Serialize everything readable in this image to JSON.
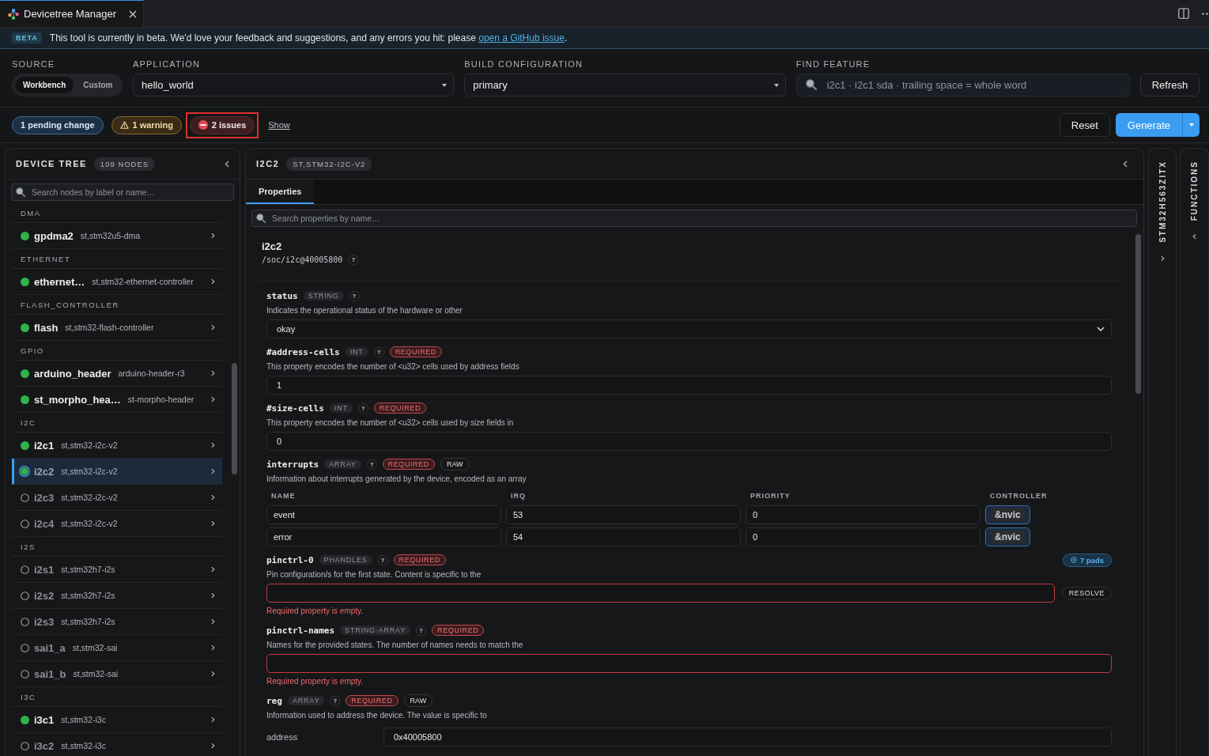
{
  "editor_tab": {
    "title": "Devicetree Manager"
  },
  "beta_banner": {
    "badge": "BETA",
    "message": "This tool is currently in beta. We'd love your feedback and suggestions, and any errors you hit: please",
    "link": "open a GitHub issue",
    "suffix": "."
  },
  "config": {
    "source": {
      "label": "SOURCE",
      "options": [
        {
          "label": "Workbench",
          "selected": true
        },
        {
          "label": "Custom",
          "selected": false
        }
      ]
    },
    "application": {
      "label": "APPLICATION",
      "value": "hello_world"
    },
    "build_configuration": {
      "label": "BUILD CONFIGURATION",
      "value": "primary"
    },
    "find_feature": {
      "label": "FIND FEATURE",
      "placeholder": "i2c1 · i2c1 sda · trailing space = whole word"
    },
    "refresh_button": "Refresh"
  },
  "status_bar": {
    "badges": [
      {
        "kind": "pending",
        "text": "1 pending change",
        "focused": false
      },
      {
        "kind": "warning",
        "text": "1 warning",
        "focused": false
      },
      {
        "kind": "error",
        "text": "2 issues",
        "focused": true
      }
    ],
    "show_link": "Show",
    "reset_button": "Reset",
    "generate_button": "Generate"
  },
  "device_tree": {
    "title": "DEVICE TREE",
    "count": "109 NODES",
    "search": {
      "placeholder": "Search nodes by label or name…"
    },
    "groups": [
      {
        "label": "DMA",
        "nodes": [
          {
            "name": "gpdma2",
            "compatible": "st,stm32u5-dma",
            "enabled": true,
            "selected": false
          }
        ]
      },
      {
        "label": "ETHERNET",
        "nodes": [
          {
            "name": "ethernet…",
            "compatible": "st,stm32-ethernet-controller",
            "enabled": true,
            "selected": false
          }
        ]
      },
      {
        "label": "FLASH_CONTROLLER",
        "nodes": [
          {
            "name": "flash",
            "compatible": "st,stm32-flash-controller",
            "enabled": true,
            "selected": false
          }
        ]
      },
      {
        "label": "GPIO",
        "nodes": [
          {
            "name": "arduino_header",
            "compatible": "arduino-header-r3",
            "enabled": true,
            "selected": false
          },
          {
            "name": "st_morpho_hea…",
            "compatible": "st-morpho-header",
            "enabled": true,
            "selected": false
          }
        ]
      },
      {
        "label": "I2C",
        "nodes": [
          {
            "name": "i2c1",
            "compatible": "st,stm32-i2c-v2",
            "enabled": true,
            "selected": false
          },
          {
            "name": "i2c2",
            "compatible": "st,stm32-i2c-v2",
            "enabled": true,
            "selected": true
          },
          {
            "name": "i2c3",
            "compatible": "st,stm32-i2c-v2",
            "enabled": false,
            "selected": false
          },
          {
            "name": "i2c4",
            "compatible": "st,stm32-i2c-v2",
            "enabled": false,
            "selected": false
          }
        ]
      },
      {
        "label": "I2S",
        "nodes": [
          {
            "name": "i2s1",
            "compatible": "st,stm32h7-i2s",
            "enabled": false,
            "selected": false
          },
          {
            "name": "i2s2",
            "compatible": "st,stm32h7-i2s",
            "enabled": false,
            "selected": false
          },
          {
            "name": "i2s3",
            "compatible": "st,stm32h7-i2s",
            "enabled": false,
            "selected": false
          },
          {
            "name": "sai1_a",
            "compatible": "st,stm32-sai",
            "enabled": false,
            "selected": false
          },
          {
            "name": "sai1_b",
            "compatible": "st,stm32-sai",
            "enabled": false,
            "selected": false
          }
        ]
      },
      {
        "label": "I3C",
        "nodes": [
          {
            "name": "i3c1",
            "compatible": "st,stm32-i3c",
            "enabled": true,
            "selected": false
          },
          {
            "name": "i3c2",
            "compatible": "st,stm32-i3c",
            "enabled": false,
            "selected": false
          }
        ]
      }
    ]
  },
  "node_panel": {
    "title": "I2C2",
    "compatible": "ST,STM32-I2C-V2",
    "tabs": [
      {
        "label": "Properties",
        "selected": true
      }
    ],
    "search": {
      "placeholder": "Search properties by name…"
    },
    "node": {
      "name": "i2c2",
      "path": "/soc/i2c@40005800",
      "help": "?"
    },
    "properties": [
      {
        "kind": "select",
        "name": "status",
        "type": "STRING",
        "help": "?",
        "description": "Indicates the operational status of the hardware or other",
        "value": "okay"
      },
      {
        "kind": "text",
        "name": "#address-cells",
        "type": "INT",
        "help": "?",
        "tags": [
          {
            "kind": "required",
            "text": "REQUIRED"
          }
        ],
        "description": "This property encodes the number of <u32> cells used by address fields",
        "value": "1"
      },
      {
        "kind": "text",
        "name": "#size-cells",
        "type": "INT",
        "help": "?",
        "tags": [
          {
            "kind": "required",
            "text": "REQUIRED"
          }
        ],
        "description": "This property encodes the number of <u32> cells used by size fields in",
        "value": "0"
      },
      {
        "kind": "table",
        "name": "interrupts",
        "type": "ARRAY",
        "help": "?",
        "tags": [
          {
            "kind": "required",
            "text": "REQUIRED"
          },
          {
            "kind": "raw",
            "text": "RAW"
          }
        ],
        "description": "Information about interrupts generated by the device, encoded as an array",
        "columns": [
          "NAME",
          "IRQ",
          "PRIORITY",
          "CONTROLLER"
        ],
        "rows": [
          {
            "cells": [
              "event",
              "53",
              "0"
            ],
            "controller": "&nvic"
          },
          {
            "cells": [
              "error",
              "54",
              "0"
            ],
            "controller": "&nvic"
          }
        ]
      },
      {
        "kind": "phandles",
        "name": "pinctrl-0",
        "type": "PHANDLES",
        "help": "?",
        "tags": [
          {
            "kind": "required",
            "text": "REQUIRED"
          }
        ],
        "pads": "7 pads",
        "description": "Pin configuration/s for the first state. Content is specific to the",
        "action": "RESOLVE",
        "error": "Required property is empty."
      },
      {
        "kind": "text",
        "name": "pinctrl-names",
        "type": "STRING-ARRAY",
        "help": "?",
        "tags": [
          {
            "kind": "required",
            "text": "REQUIRED"
          }
        ],
        "description": "Names for the provided states. The number of names needs to match the",
        "error": "Required property is empty."
      },
      {
        "kind": "fields",
        "name": "reg",
        "type": "ARRAY",
        "help": "?",
        "tags": [
          {
            "kind": "required",
            "text": "REQUIRED"
          },
          {
            "kind": "raw",
            "text": "RAW"
          }
        ],
        "description": "Information used to address the device. The value is specific to",
        "fields": [
          {
            "label": "address",
            "value": "0x40005800"
          }
        ]
      }
    ]
  },
  "side_panels": [
    {
      "kind": "device",
      "title": "STM32H563ZITX"
    },
    {
      "kind": "functions",
      "title": "FUNCTIONS"
    }
  ]
}
